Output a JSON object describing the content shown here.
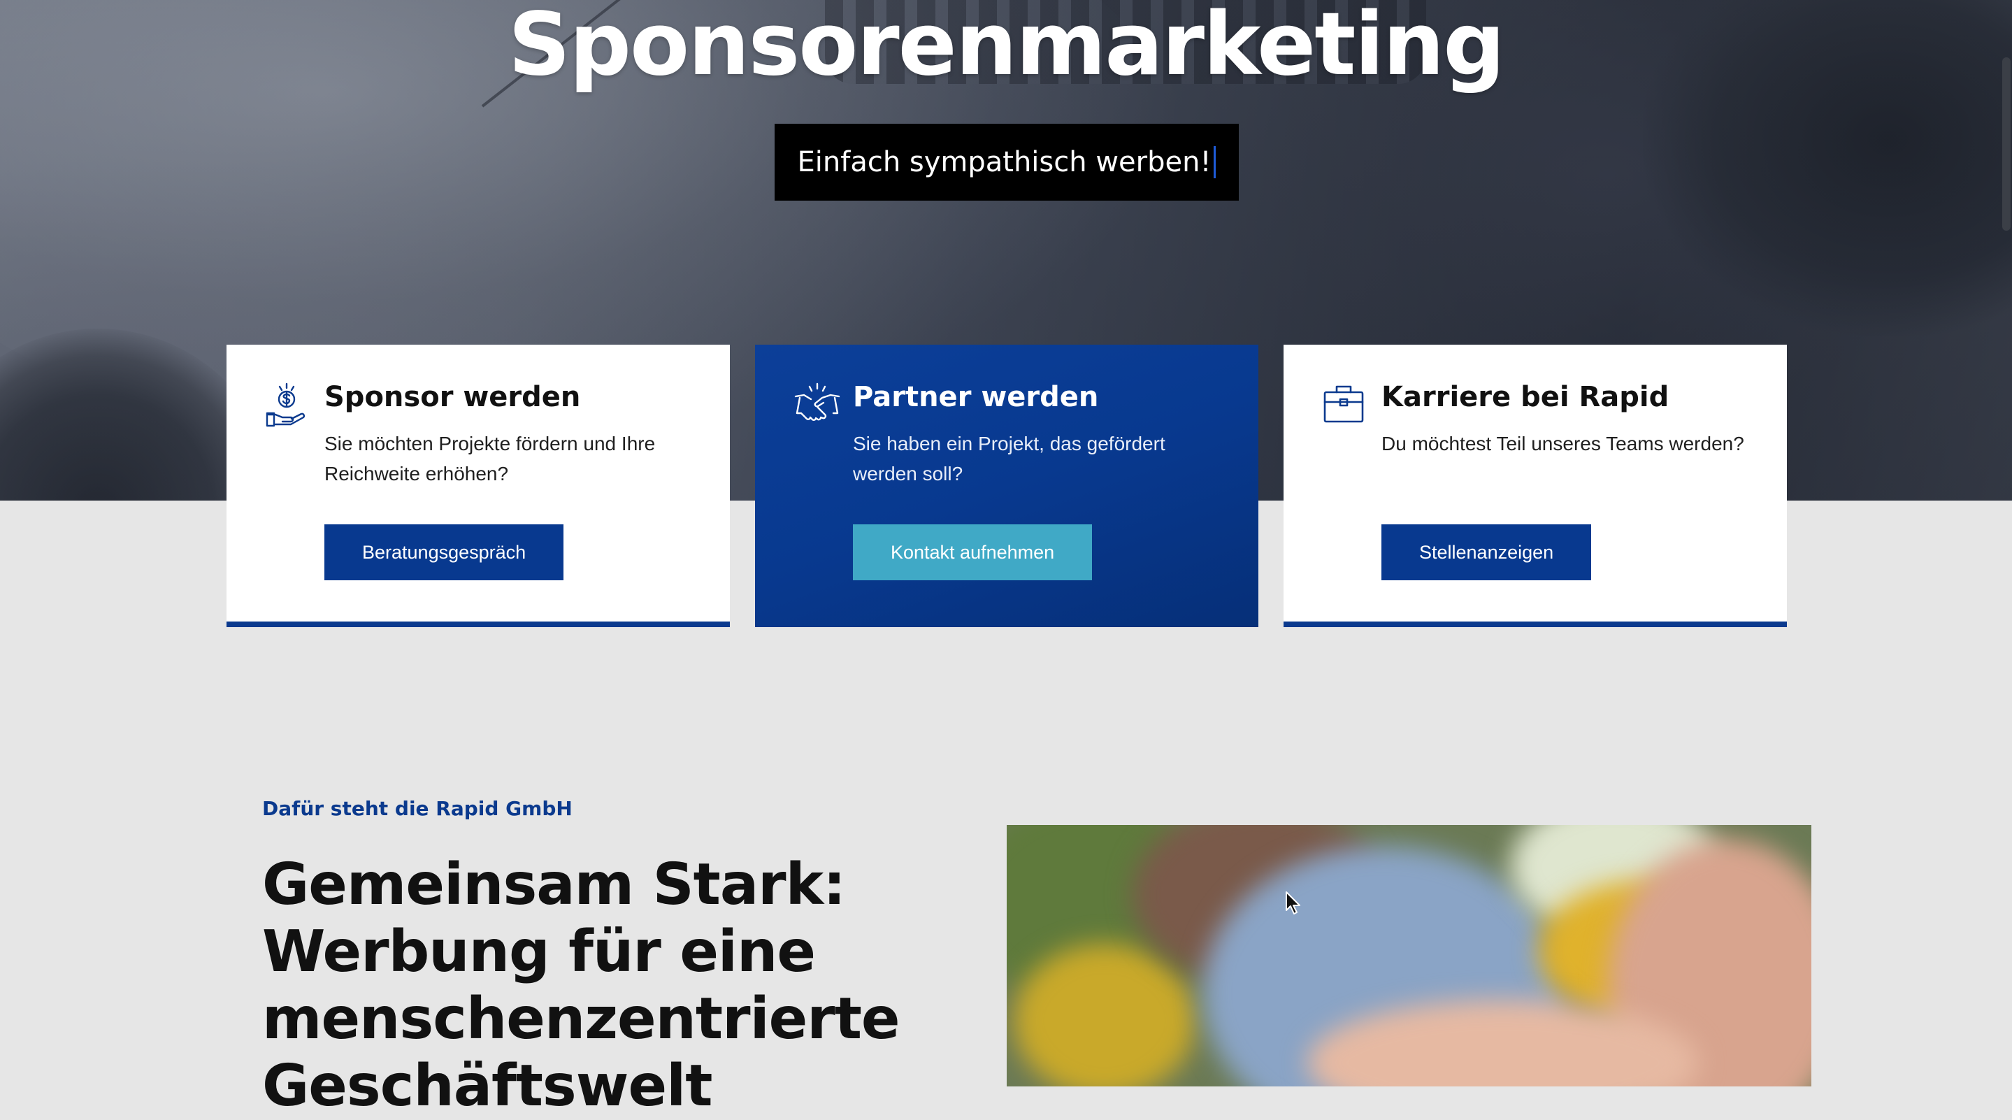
{
  "hero": {
    "title": "Sponsorenmarketing",
    "tagline": "Einfach sympathisch werben!"
  },
  "cards": [
    {
      "icon": "hand-money-icon",
      "title": "Sponsor werden",
      "text": "Sie möchten Projekte fördern und Ihre Reichweite erhöhen?",
      "button": "Beratungsgespräch"
    },
    {
      "icon": "handshake-icon",
      "title": "Partner werden",
      "text": "Sie haben ein Projekt, das gefördert werden soll?",
      "button": "Kontakt aufnehmen"
    },
    {
      "icon": "briefcase-icon",
      "title": "Karriere bei Rapid",
      "text": "Du möchtest Teil unseres Teams werden?",
      "button": "Stellenanzeigen"
    }
  ],
  "about": {
    "eyebrow": "Dafür steht die Rapid GmbH",
    "heading": "Gemeinsam Stark: Werbung für eine menschenzentrierte Geschäftswelt"
  },
  "colors": {
    "brand_blue": "#08398f",
    "accent_teal": "#40a9c6",
    "background": "#e6e6e6"
  }
}
